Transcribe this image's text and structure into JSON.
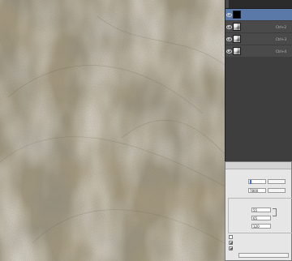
{
  "panel": {
    "tabs": [
      "",
      "",
      "",
      "",
      ""
    ],
    "channels": [
      {
        "name": "",
        "shortcut": "",
        "thumb": "black",
        "active": true
      },
      {
        "name": "",
        "shortcut": "Ctrl+2",
        "thumb": "texture",
        "active": false
      },
      {
        "name": "",
        "shortcut": "Ctrl+3",
        "thumb": "texture",
        "active": false
      },
      {
        "name": "",
        "shortcut": "Ctrl+4",
        "thumb": "texture",
        "active": false
      }
    ]
  },
  "dialog": {
    "title": "",
    "image_size": "",
    "dimensions_label": "",
    "width_label": "",
    "width_value": "",
    "width_unit": "",
    "height_label": "",
    "height_value": "7800",
    "height_unit": "",
    "doc_size_label": "",
    "doc_width_label": "",
    "doc_width_value": "55",
    "doc_width_unit": "",
    "doc_height_label": "",
    "doc_height_value": "65",
    "doc_height_unit": "",
    "resolution_label": "",
    "resolution_value": "120",
    "resolution_unit": "",
    "scale_styles": "",
    "constrain_proportions": "",
    "resample": "",
    "resample_method": ""
  }
}
